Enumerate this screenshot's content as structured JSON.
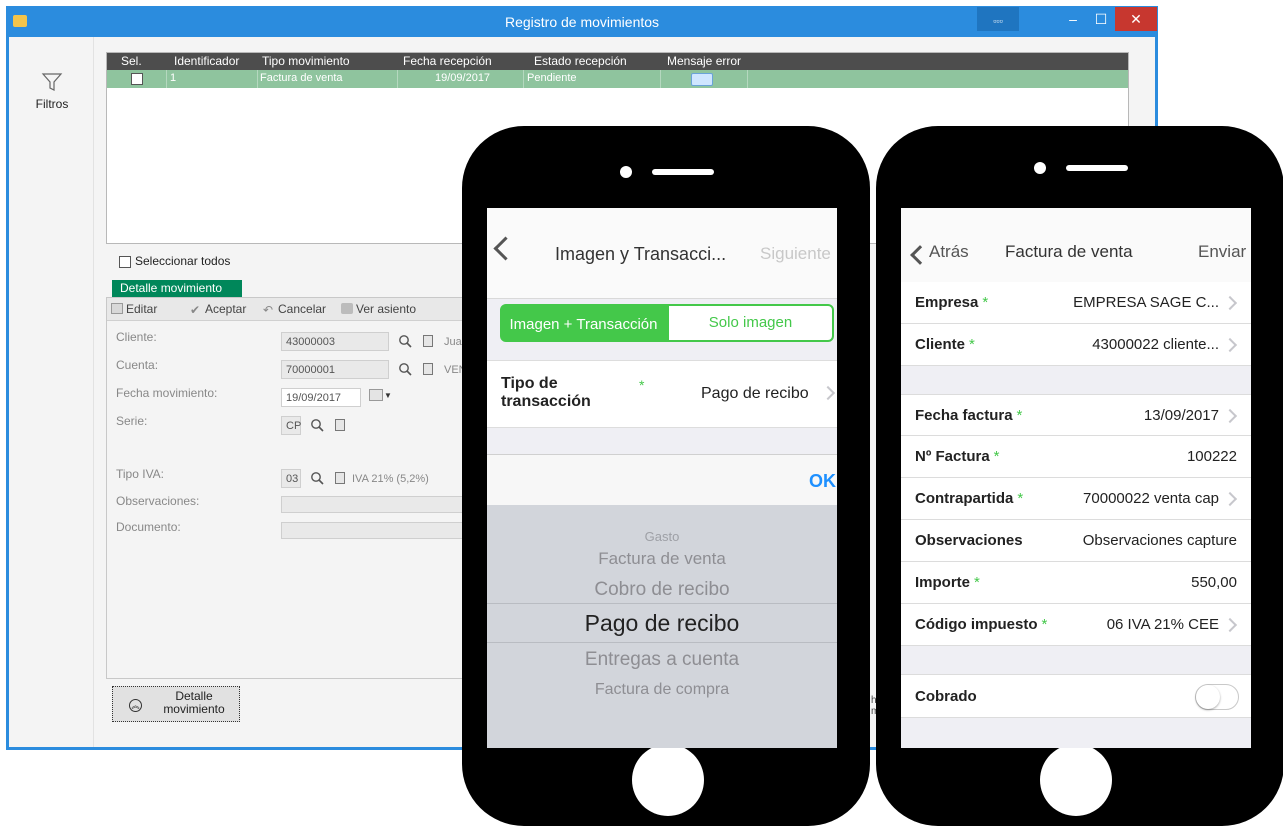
{
  "window": {
    "title": "Registro de movimientos",
    "extra_button": "▫▫▫",
    "min": "–",
    "max": "☐",
    "close": "✕"
  },
  "sidebar": {
    "filters_label": "Filtros",
    "filter_icon": "funnel-icon"
  },
  "grid": {
    "columns": [
      "Sel.",
      "Identificador",
      "Tipo movimiento",
      "Fecha recepción",
      "Estado recepción",
      "Mensaje error"
    ],
    "rows": [
      {
        "id": "1",
        "tipo": "Factura de venta",
        "fecha": "19/09/2017",
        "estado": "Pendiente"
      }
    ]
  },
  "select_all": "Seleccionar todos",
  "detalle": {
    "tab": "Detalle movimiento",
    "toolbar": {
      "editar": "Editar",
      "aceptar": "Aceptar",
      "cancelar": "Cancelar",
      "ver_asiento": "Ver asiento"
    },
    "fields": {
      "cliente_label": "Cliente:",
      "cliente_value": "43000003",
      "cliente_desc": "Jua",
      "cuenta_label": "Cuenta:",
      "cuenta_value": "70000001",
      "cuenta_desc": "VEN",
      "fecha_label": "Fecha movimiento:",
      "fecha_value": "19/09/2017",
      "serie_label": "Serie:",
      "serie_value": "CP",
      "iva_label": "Tipo IVA:",
      "iva_value": "03",
      "iva_desc": "IVA 21% (5,2%)",
      "obs_label": "Observaciones:",
      "doc_label": "Documento:"
    },
    "bottom_button": [
      "Detalle",
      "movimiento"
    ],
    "partial_text": [
      "ha",
      "mi"
    ]
  },
  "phone1": {
    "nav_title": "Imagen y Transacci...",
    "nav_next": "Siguiente",
    "segment_left": "Imagen + Transacción",
    "segment_right": "Solo imagen",
    "row_label": "Tipo de transacción",
    "row_star": "*",
    "row_value": "Pago de recibo",
    "ok": "OK",
    "picker": [
      "Gasto",
      "Factura de venta",
      "Cobro de recibo",
      "Pago de recibo",
      "Entregas a cuenta",
      "Factura de compra"
    ]
  },
  "phone2": {
    "back": "Atrás",
    "title": "Factura de venta",
    "send": "Enviar",
    "fields": [
      {
        "label": "Empresa",
        "required": "*",
        "value": "EMPRESA SAGE C..."
      },
      {
        "label": "Cliente",
        "required": "*",
        "value": "43000022 cliente..."
      },
      {
        "label": "Fecha factura",
        "required": "*",
        "value": "13/09/2017"
      },
      {
        "label": "Nº Factura",
        "required": "*",
        "value": "100222"
      },
      {
        "label": "Contrapartida",
        "required": "*",
        "value": "70000022 venta cap"
      },
      {
        "label": "Observaciones",
        "required": "",
        "value": "Observaciones capture"
      },
      {
        "label": "Importe",
        "required": "*",
        "value": "550,00"
      },
      {
        "label": "Código impuesto",
        "required": "*",
        "value": "06 IVA 21% CEE"
      },
      {
        "label": "Cobrado",
        "required": "",
        "value": ""
      }
    ],
    "cobrado_on": false
  },
  "colors": {
    "win_blue": "#2b8cde",
    "grid_row": "#8fc49e",
    "accent_green": "#44c84a",
    "ok_blue": "#1e90ff",
    "tab_green": "#00875a"
  }
}
